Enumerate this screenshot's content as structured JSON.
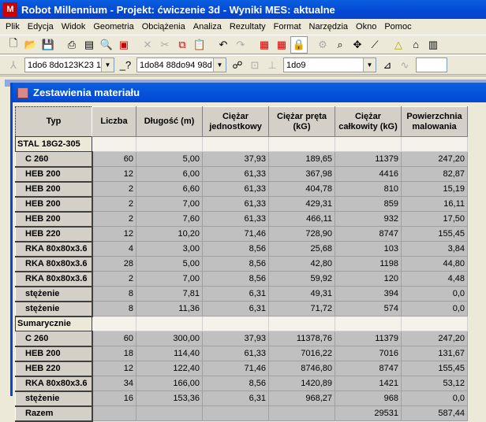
{
  "app": {
    "title": "Robot Millennium - Projekt: ćwiczenie 3d - Wyniki MES: aktualne"
  },
  "menu": [
    "Plik",
    "Edycja",
    "Widok",
    "Geometria",
    "Obciążenia",
    "Analiza",
    "Rezultaty",
    "Format",
    "Narzędzia",
    "Okno",
    "Pomoc"
  ],
  "toolbar2": {
    "combo1": "1do6 8do123K23 1",
    "combo2": "1do84 88do94 98d",
    "combo3": "1do9"
  },
  "window": {
    "title": "Zestawienia materiału"
  },
  "table": {
    "headers": [
      "Typ",
      "Liczba",
      "Długość (m)",
      "Ciężar jednostkowy",
      "Ciężar pręta (kG)",
      "Ciężar całkowity (kG)",
      "Powierzchnia malowania"
    ],
    "rows": [
      {
        "g": "STAL 18G2-305"
      },
      {
        "c": [
          "C 260",
          "60",
          "5,00",
          "37,93",
          "189,65",
          "11379",
          "247,20"
        ]
      },
      {
        "c": [
          "HEB 200",
          "12",
          "6,00",
          "61,33",
          "367,98",
          "4416",
          "82,87"
        ]
      },
      {
        "c": [
          "HEB 200",
          "2",
          "6,60",
          "61,33",
          "404,78",
          "810",
          "15,19"
        ]
      },
      {
        "c": [
          "HEB 200",
          "2",
          "7,00",
          "61,33",
          "429,31",
          "859",
          "16,11"
        ]
      },
      {
        "c": [
          "HEB 200",
          "2",
          "7,60",
          "61,33",
          "466,11",
          "932",
          "17,50"
        ]
      },
      {
        "c": [
          "HEB 220",
          "12",
          "10,20",
          "71,46",
          "728,90",
          "8747",
          "155,45"
        ]
      },
      {
        "c": [
          "RKA 80x80x3.6",
          "4",
          "3,00",
          "8,56",
          "25,68",
          "103",
          "3,84"
        ]
      },
      {
        "c": [
          "RKA 80x80x3.6",
          "28",
          "5,00",
          "8,56",
          "42,80",
          "1198",
          "44,80"
        ]
      },
      {
        "c": [
          "RKA 80x80x3.6",
          "2",
          "7,00",
          "8,56",
          "59,92",
          "120",
          "4,48"
        ]
      },
      {
        "c": [
          "stężenie",
          "8",
          "7,81",
          "6,31",
          "49,31",
          "394",
          "0,0"
        ]
      },
      {
        "c": [
          "stężenie",
          "8",
          "11,36",
          "6,31",
          "71,72",
          "574",
          "0,0"
        ]
      },
      {
        "g": "Sumarycznie"
      },
      {
        "c": [
          "C 260",
          "60",
          "300,00",
          "37,93",
          "11378,76",
          "11379",
          "247,20"
        ]
      },
      {
        "c": [
          "HEB 200",
          "18",
          "114,40",
          "61,33",
          "7016,22",
          "7016",
          "131,67"
        ]
      },
      {
        "c": [
          "HEB 220",
          "12",
          "122,40",
          "71,46",
          "8746,80",
          "8747",
          "155,45"
        ]
      },
      {
        "c": [
          "RKA 80x80x3.6",
          "34",
          "166,00",
          "8,56",
          "1420,89",
          "1421",
          "53,12"
        ]
      },
      {
        "c": [
          "stężenie",
          "16",
          "153,36",
          "6,31",
          "968,27",
          "968",
          "0,0"
        ]
      },
      {
        "c": [
          "Razem",
          "",
          "",
          "",
          "",
          "29531",
          "587,44"
        ]
      }
    ]
  }
}
